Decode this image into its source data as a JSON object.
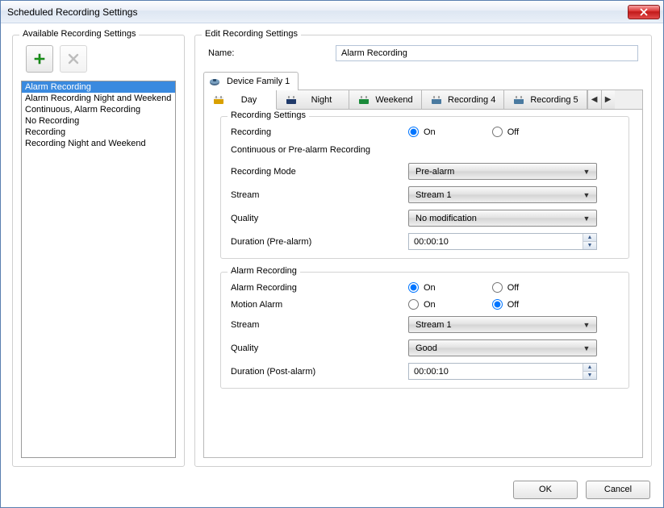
{
  "window": {
    "title": "Scheduled Recording Settings"
  },
  "left": {
    "title": "Available Recording Settings",
    "items": [
      "Alarm Recording",
      "Alarm Recording Night and Weekend",
      "Continuous, Alarm Recording",
      "No Recording",
      "Recording",
      "Recording Night and Weekend"
    ],
    "selected_index": 0
  },
  "right": {
    "title": "Edit Recording Settings",
    "name_label": "Name:",
    "name_value": "Alarm Recording",
    "outer_tab": "Device Family 1",
    "inner_tabs": [
      "Day",
      "Night",
      "Weekend",
      "Recording 4",
      "Recording 5"
    ],
    "inner_tab_active": 0,
    "groups": {
      "rec": {
        "title": "Recording Settings",
        "recording_label": "Recording",
        "on": "On",
        "off": "Off",
        "recording_value": "On",
        "cpr_label": "Continuous or Pre-alarm Recording",
        "mode_label": "Recording Mode",
        "mode_value": "Pre-alarm",
        "stream_label": "Stream",
        "stream_value": "Stream 1",
        "quality_label": "Quality",
        "quality_value": "No modification",
        "prealarm_label": "Duration (Pre-alarm)",
        "prealarm_value": "00:00:10"
      },
      "alarm": {
        "title": "Alarm Recording",
        "ar_label": "Alarm Recording",
        "ar_value": "On",
        "motion_label": "Motion Alarm",
        "motion_value": "Off",
        "stream_label": "Stream",
        "stream_value": "Stream 1",
        "quality_label": "Quality",
        "quality_value": "Good",
        "post_label": "Duration (Post-alarm)",
        "post_value": "00:00:10",
        "on": "On",
        "off": "Off"
      }
    }
  },
  "footer": {
    "ok": "OK",
    "cancel": "Cancel"
  }
}
